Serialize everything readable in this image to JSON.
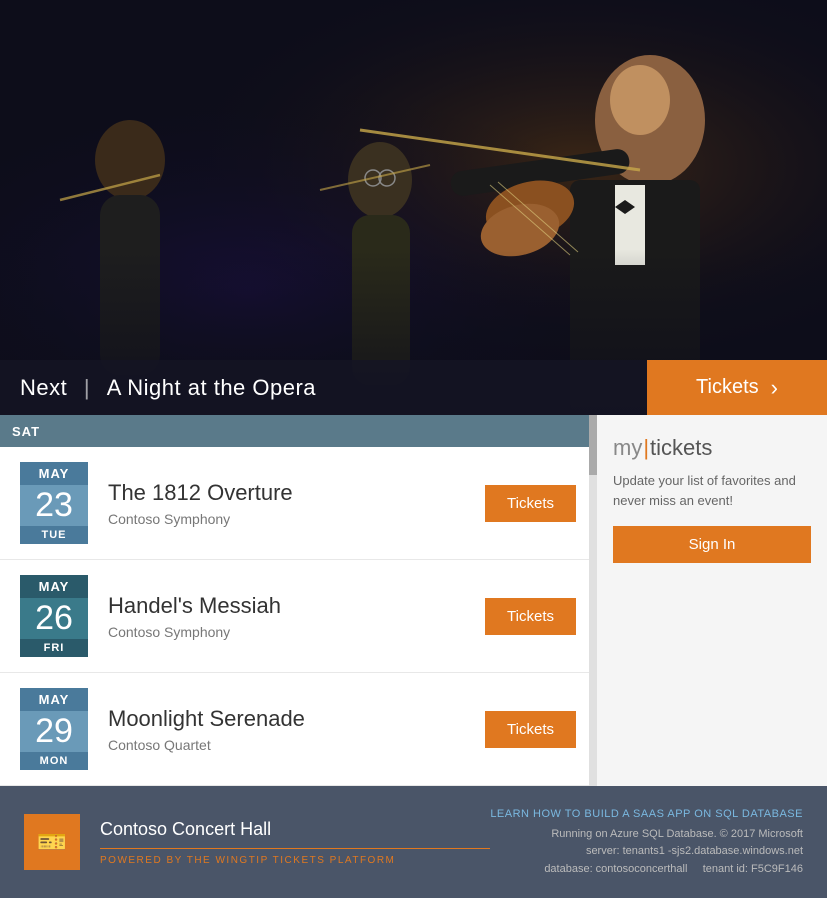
{
  "hero": {
    "next_label": "Next",
    "divider": "|",
    "event_title": "A Night at the Opera",
    "tickets_label": "Tickets",
    "tickets_arrow": "›"
  },
  "date_header": {
    "label": "SAT"
  },
  "events": [
    {
      "month": "MAY",
      "day": "23",
      "weekday": "TUE",
      "title": "The 1812 Overture",
      "venue": "Contoso Symphony",
      "tickets_label": "Tickets",
      "date_color_month": "#4a7a9b",
      "date_color_day": "#6a9ab8",
      "date_color_weekday": "#4a7a9b"
    },
    {
      "month": "MAY",
      "day": "26",
      "weekday": "FRI",
      "title": "Handel's Messiah",
      "venue": "Contoso Symphony",
      "tickets_label": "Tickets",
      "date_color_month": "#2a5a6a",
      "date_color_day": "#3a7a8a",
      "date_color_weekday": "#2a5a6a"
    },
    {
      "month": "MAY",
      "day": "29",
      "weekday": "MON",
      "title": "Moonlight Serenade",
      "venue": "Contoso Quartet",
      "tickets_label": "Tickets",
      "date_color_month": "#4a7a9b",
      "date_color_day": "#6a9ab8",
      "date_color_weekday": "#4a7a9b"
    }
  ],
  "sidebar": {
    "my_label": "my",
    "divider": "|",
    "tickets_label": "tickets",
    "description": "Update your list of favorites and never miss an event!",
    "sign_in_label": "Sign In"
  },
  "footer": {
    "brand_name": "Contoso Concert Hall",
    "powered_by": "POWERED BY THE WINGTIP TICKETS PLATFORM",
    "learn_link": "LEARN HOW TO BUILD A SAAS APP ON SQL DATABASE",
    "line1": "Running on Azure SQL Database. © 2017 Microsoft",
    "line2": "server: tenants1 -sjs2.database.windows.net",
    "line3_a": "database: contosoconcerthall",
    "line3_b": "tenant id: F5C9F146"
  }
}
